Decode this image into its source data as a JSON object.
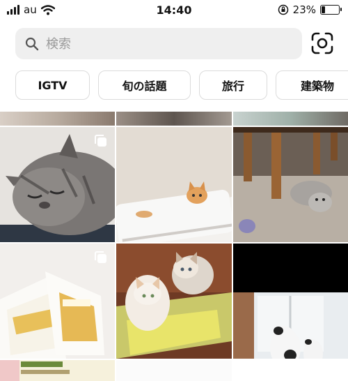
{
  "status": {
    "carrier": "au",
    "time": "14:40",
    "battery": "23%",
    "battery_level": 0.23
  },
  "search": {
    "placeholder": "検索",
    "value": ""
  },
  "chips": [
    "IGTV",
    "旬の話題",
    "旅行",
    "建築物"
  ],
  "icons": {
    "search": "search-icon",
    "scan": "qr-scan-icon",
    "multi": "carousel-icon"
  }
}
